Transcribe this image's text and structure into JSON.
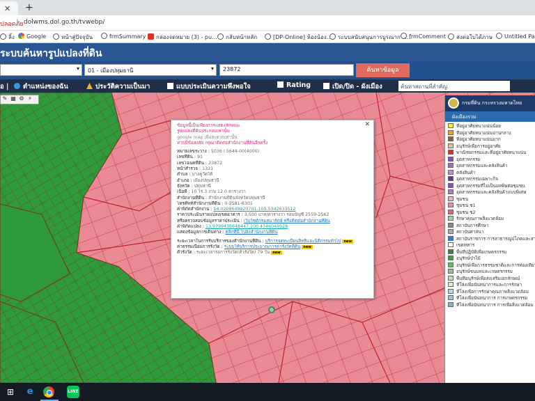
{
  "browser": {
    "tab_close": "✕",
    "new_tab": "+",
    "url_warning": "ปลอดภัย",
    "url": "dolwms.dol.go.th/tvwebp/",
    "bookmarks": [
      {
        "label": "ลิ้ง",
        "icon": "globe-icon"
      },
      {
        "label": "Google",
        "icon": "google-icon"
      },
      {
        "label": "หน้าสู่ปัจจุบัน",
        "icon": "globe-icon"
      },
      {
        "label": "frmSummary",
        "icon": "globe-icon"
      },
      {
        "label": "กล่องจดหมาย (3) - pu...",
        "icon": "gmail-icon"
      },
      {
        "label": "กลับหน้าหลัก",
        "icon": "globe-icon"
      },
      {
        "label": "[DP-Online] ห้องน้อง...",
        "icon": "globe-icon"
      },
      {
        "label": "ระบบสนับสนุนการบูรณาการ...",
        "icon": "globe-icon"
      },
      {
        "label": "frmComment",
        "icon": "globe-icon"
      },
      {
        "label": "ส่งต่อใบได้ภาษ",
        "icon": "globe-icon"
      },
      {
        "label": "Untitled Page",
        "icon": "globe-icon"
      }
    ]
  },
  "app": {
    "title": "ระบบค้นหารูปแปลงที่ดิน",
    "province_select": "",
    "district_select": "01 - เมืองปทุมธานี",
    "parcel_input": "23872",
    "search_button": "ค้นหาข้อมูล",
    "toolbar": {
      "location": "ตำแหน่งของฉัน",
      "history": "ประวัติความเป็นมา",
      "survey": "แบบประเมินความพึงพอใจ",
      "rating": "Rating",
      "toggle": "เปิด/ปิด - ผังเมือง",
      "place_search_placeholder": "ค้นหาสถานที่สำคัญ"
    }
  },
  "map": {
    "tools": [
      "✎",
      "▦",
      "⚙",
      "⚡"
    ],
    "colors": {
      "residential": "#e98a95",
      "agricultural": "#2f9a3c",
      "boundary": "#c0202a",
      "agri_lines": "#7a3020"
    }
  },
  "popup": {
    "close": "✕",
    "warning_lines": [
      "ข้อมูลนี้เป็นเพียงการแสดงลักษณะ",
      "รูปแปลงที่ดินประกอบเท่านั้น",
      "google map เพื่อสะดวกเท่านั้น",
      "หากมีข้อสงสัย กรุณาติดต่อสำนักงานที่ดินอีกครั้ง"
    ],
    "fields": [
      {
        "label": "หมายเลขระวาง :",
        "value": "5036 I 5644-00(4000)"
      },
      {
        "label": "เลขที่ดิน :",
        "value": "91"
      },
      {
        "label": "เลขโฉนดที่ดิน :",
        "value": "23872"
      },
      {
        "label": "หน้าสำรวจ :",
        "value": "1321"
      },
      {
        "label": "ตำบล :",
        "value": "บางคูวัดใต้"
      },
      {
        "label": "อำเภอ :",
        "value": "เมืองปทุมธานี"
      },
      {
        "label": "จังหวัด :",
        "value": "ปทุมธานี"
      },
      {
        "label": "เนื้อที่ :",
        "value": "10 ไร่ 3 งาน 12.0 ตารางวา"
      },
      {
        "label": "สำนักงานที่ดิน :",
        "value": "สำนักงานที่ดินจังหวัดปทุมธานี"
      },
      {
        "label": "โทรศัพท์สำนักงานที่ดิน :",
        "value": "0-2581-6301"
      },
      {
        "label": "ค่าพิกัดสำนักงาน :",
        "value": "14.0208649920701,100.5342633512"
      },
      {
        "label": "ราคาประเมินรายแปลงเขตอาคาร :",
        "value": "3,500 บาท/ตารางวา รอบบัญชี 2559-2562"
      },
      {
        "label": "หรือตรวจสอบข้อมูลราคาประเมิน :",
        "value": "เว็บไซต์กรมธนารักษ์ หรือติดต่อสำนักงานที่ดิน"
      },
      {
        "label": "ค่าพิกัดแปลง :",
        "value": "13.9799436648447,100.4746049528"
      },
      {
        "label": "แสดงข้อมูลการเดินทาง :",
        "value": "คลิกที่นี่ ไปยังสำนักงานที่ดิน"
      }
    ],
    "services": [
      {
        "label": "ระยะเวลาในการรับบริการของสำนักงานที่ดิน :",
        "value": "บริการจดทะเบียนสิทธิและนิติกรรมทั่วไป"
      },
      {
        "label": "ค่าธรรมเนียมการรังวัด :",
        "value": "ระบบให้บริการประมาณการค่ารังวัดที่ดิน"
      },
      {
        "label": "ตัวรังวัด :",
        "value": "ระยะเวลารอการรังวัด(ตัวรังวัด) 79 วัน"
      }
    ],
    "new_badge": "new"
  },
  "legend": {
    "header": "กรมที่ดิน กระทรวงมหาดไทย",
    "sub": "ผังเมืองรวม",
    "items": [
      {
        "label": "ที่อยู่อาศัยหนาแน่นน้อย",
        "color": "#f4e84a"
      },
      {
        "label": "ที่อยู่อาศัยหนาแน่นปานกลาง",
        "color": "#e8a23a"
      },
      {
        "label": "ที่อยู่อาศัยหนาแน่นมาก",
        "color": "#9a5a2a"
      },
      {
        "label": "อนุรักษ์เพื่อการอยู่อาศัย",
        "color": "#d8c890"
      },
      {
        "label": "พาณิชยกรรมและที่อยู่อาศัยหนาแน่น",
        "color": "#d0303a"
      },
      {
        "label": "อุตสาหกรรม",
        "color": "#8e4bb0"
      },
      {
        "label": "อุตสาหกรรมและคลังสินค้า",
        "color": "#a070c8"
      },
      {
        "label": "คลังสินค้า",
        "color": "#b890e0"
      },
      {
        "label": "อุตสาหกรรมเฉพาะกิจ",
        "color": "#6a3a8a"
      },
      {
        "label": "อุตสาหกรรมที่ไม่เป็นมลพิษต่อชุมชน",
        "color": "#7a5aa0"
      },
      {
        "label": "อุตสาหกรรมและคลังสินค้าแบบพิเศษ",
        "color": "#b07ac0"
      },
      {
        "label": "ชุมชน",
        "color": "#f0b0c0"
      },
      {
        "label": "ชุมชน ช1",
        "color": "#e88aa0"
      },
      {
        "label": "ชุมชน ช2",
        "color": "#d86a80"
      },
      {
        "label": "รักษาคุณภาพสิ่งแวดล้อม",
        "color": "#a8d0a0"
      },
      {
        "label": "สถาบันการศึกษา",
        "color": "#888"
      },
      {
        "label": "สถาบันศาสนา",
        "color": "#aaa"
      },
      {
        "label": "สถาบันราชการ การสาธารณูปโภคและสาธารณูปการ",
        "color": "#3a7ac8"
      },
      {
        "label": "เขตทหาร",
        "color": "#ffffff"
      },
      {
        "label": "พื้นที่ปฏิบัติเพื่อเกษตรกรรม",
        "color": "#2f8a3c"
      },
      {
        "label": "อนุรักษ์ป่าไม้",
        "color": "#4a9a4a"
      },
      {
        "label": "อนุรักษ์เพื่อการธรรมชาติและการท่องเที่ยว",
        "color": "#6ab86a"
      },
      {
        "label": "อนุรักษ์ชนบทและเกษตรกรรม",
        "color": "#8ac88a"
      },
      {
        "label": "พื้นที่อนุรักษ์เพื่อส่งเสริมเอกลักษณ์",
        "color": "#c8e0a8"
      },
      {
        "label": "ที่โล่งเพื่อนันทนาการและการรักษา",
        "color": "#d8f0c8"
      },
      {
        "label": "ที่โล่งเพื่อการรักษาคุณภาพสิ่งแวดล้อม",
        "color": "#b8d8e8"
      },
      {
        "label": "ที่โล่งเพื่อนันทนาการ การเกษตรกรรม",
        "color": "#98c8d8"
      },
      {
        "label": "ที่โล่งเพื่อนันทนาการ การเพื่อสิ่งแวดล้อม",
        "color": "#78b8c8"
      }
    ]
  },
  "taskbar": {
    "start": "⊞",
    "ie": "e",
    "line": "LINE"
  }
}
